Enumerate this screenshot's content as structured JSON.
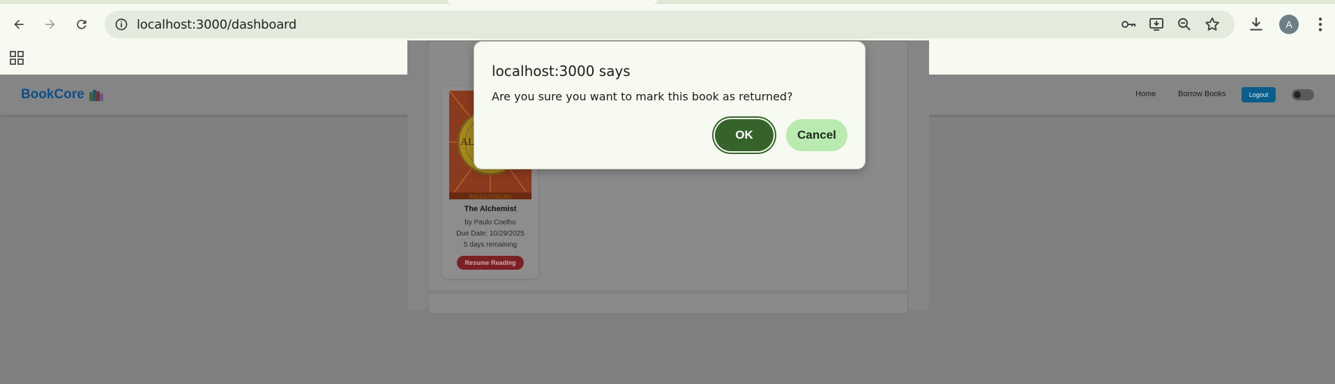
{
  "browser": {
    "url": "localhost:3000/dashboard",
    "profile_initial": "A",
    "icons": {
      "back": "back-arrow-icon",
      "forward": "forward-arrow-icon",
      "reload": "reload-icon",
      "site_info": "site-info-icon",
      "password": "key-icon",
      "install": "install-app-icon",
      "zoom": "zoom-out-icon",
      "bookmark": "star-icon",
      "downloads": "download-icon",
      "menu": "more-vert-icon",
      "apps": "apps-grid-icon"
    }
  },
  "app": {
    "brand": "BookCore",
    "brand_icon": "books-icon",
    "nav": {
      "home": "Home",
      "borrow": "Borrow Books",
      "logout": "Logout"
    },
    "theme_toggle": "off"
  },
  "book": {
    "cover_title": "The ALCHEMIST",
    "cover_author": "PAULO COELHO",
    "title": "The Alchemist",
    "author": "by Paulo Coelho",
    "due": "Due Date: 10/29/2025",
    "remaining": "5 days remaining",
    "action": "Resume Reading"
  },
  "dialog": {
    "title": "localhost:3000 says",
    "message": "Are you sure you want to mark this book as returned?",
    "ok": "OK",
    "cancel": "Cancel"
  },
  "colors": {
    "chrome_bg": "#f6faf0",
    "ok_bg": "#36632a",
    "cancel_bg": "#b9eab0",
    "brand": "#0b4f86"
  }
}
